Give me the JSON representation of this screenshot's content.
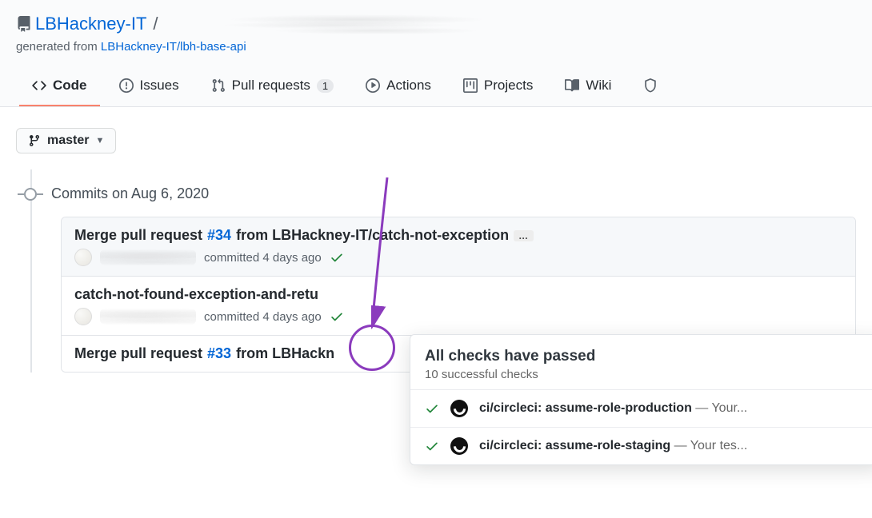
{
  "repo": {
    "owner": "LBHackney-IT",
    "separator": "/",
    "generated_prefix": "generated from ",
    "generated_link": "LBHackney-IT/lbh-base-api"
  },
  "nav": {
    "code": "Code",
    "issues": "Issues",
    "pulls": "Pull requests",
    "pulls_count": "1",
    "actions": "Actions",
    "projects": "Projects",
    "wiki": "Wiki"
  },
  "branch": {
    "name": "master"
  },
  "timeline": {
    "date": "Commits on Aug 6, 2020"
  },
  "commits": [
    {
      "prefix": "Merge pull request ",
      "pr": "#34",
      "suffix": " from LBHackney-IT/catch-not-exception",
      "committed": " committed 4 days ago"
    },
    {
      "title_partial": "catch-not-found-exception-and-retu",
      "committed": " committed 4 days ago"
    },
    {
      "prefix": "Merge pull request ",
      "pr": "#33",
      "suffix": " from LBHackn"
    }
  ],
  "popover": {
    "title": "All checks have passed",
    "subtitle": "10 successful checks",
    "checks": [
      {
        "name": "ci/circleci: assume-role-production",
        "trail": " — Your..."
      },
      {
        "name": "ci/circleci: assume-role-staging",
        "trail": " — Your tes..."
      }
    ]
  }
}
